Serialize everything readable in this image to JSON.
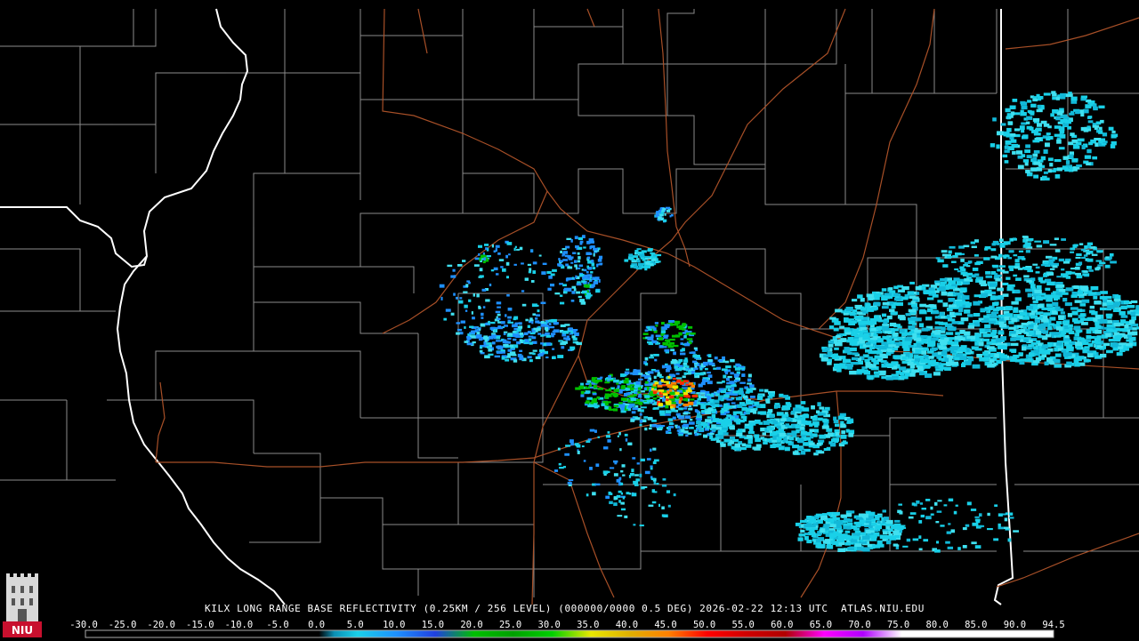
{
  "caption": {
    "product": "KILX LONG RANGE BASE REFLECTIVITY (0.25KM / 256 LEVEL) (000000/0000 0.5 DEG) 2026-02-22 12:13 UTC  ATLAS.NIU.EDU"
  },
  "color_scale": {
    "labels": [
      "-30.0",
      "-25.0",
      "-20.0",
      "-15.0",
      "-10.0",
      "-5.0",
      "0.0",
      "5.0",
      "10.0",
      "15.0",
      "20.0",
      "25.0",
      "30.0",
      "35.0",
      "40.0",
      "45.0",
      "50.0",
      "55.0",
      "60.0",
      "65.0",
      "70.0",
      "75.0",
      "80.0",
      "85.0",
      "90.0",
      "94.5"
    ],
    "stops": [
      {
        "value": -30,
        "color": "#000000"
      },
      {
        "value": 0,
        "color": "#000000"
      },
      {
        "value": 2,
        "color": "#0b8fb4"
      },
      {
        "value": 5,
        "color": "#19d0e8"
      },
      {
        "value": 10,
        "color": "#1e90ff"
      },
      {
        "value": 15,
        "color": "#2040e0"
      },
      {
        "value": 20,
        "color": "#00c000"
      },
      {
        "value": 25,
        "color": "#00a000"
      },
      {
        "value": 30,
        "color": "#00d000"
      },
      {
        "value": 35,
        "color": "#e8e800"
      },
      {
        "value": 40,
        "color": "#e0b000"
      },
      {
        "value": 45,
        "color": "#ff8000"
      },
      {
        "value": 50,
        "color": "#ff0000"
      },
      {
        "value": 55,
        "color": "#d00000"
      },
      {
        "value": 60,
        "color": "#b00000"
      },
      {
        "value": 65,
        "color": "#ff00ff"
      },
      {
        "value": 70,
        "color": "#b000ff"
      },
      {
        "value": 75,
        "color": "#ffffff"
      },
      {
        "value": 94.5,
        "color": "#ffffff"
      }
    ]
  },
  "logo": {
    "text": "NIU",
    "background": "#c8102e"
  },
  "colors": {
    "state_border": "#ffffff",
    "county_border": "#a8a8a8",
    "highway": "#b0542a",
    "echo_light": "#19d0e8",
    "echo_moderate": "#1e90ff",
    "echo_heavy": "#00c000",
    "echo_intense": "#e8e800",
    "echo_core": "#ff2a00"
  }
}
